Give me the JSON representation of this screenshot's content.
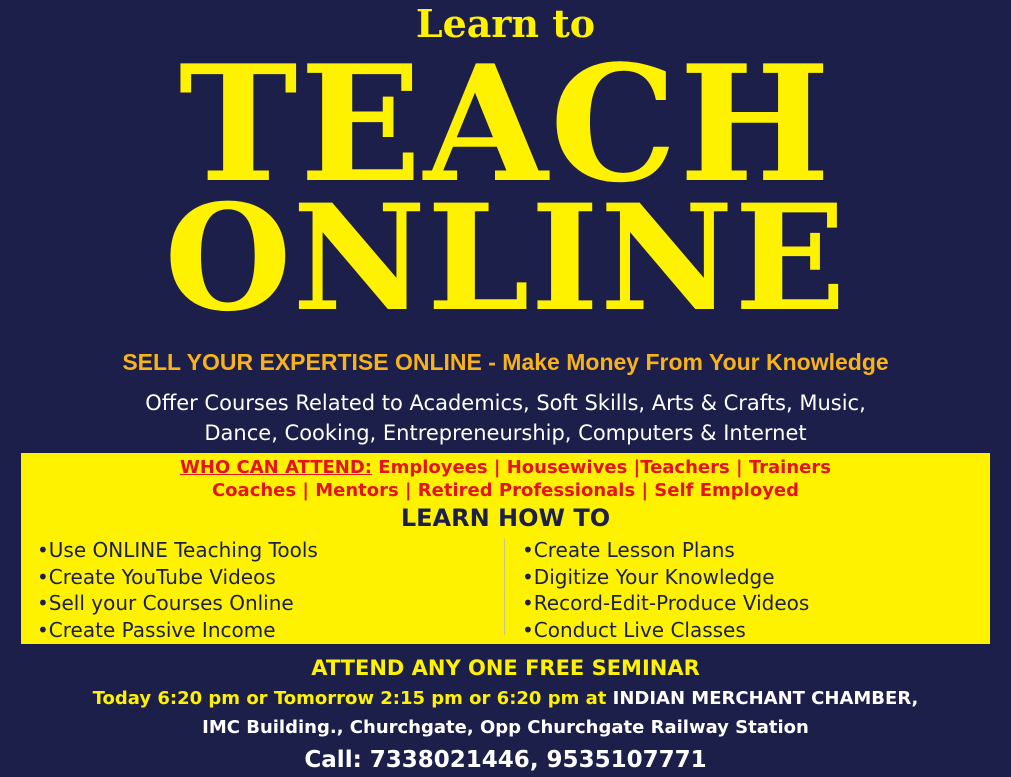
{
  "header": {
    "kicker": "Learn to",
    "line1": "TEACH",
    "line2": "ONLINE"
  },
  "tagline": "SELL YOUR EXPERTISE ONLINE - Make Money From Your Knowledge",
  "offer": {
    "line1": "Offer Courses Related to Academics, Soft Skills, Arts & Crafts, Music,",
    "line2": "Dance, Cooking, Entrepreneurship, Computers & Internet"
  },
  "who": {
    "label": "WHO CAN ATTEND:",
    "line1_rest": " Employees | Housewives |Teachers | Trainers",
    "line2": "Coaches | Mentors | Retired Professionals | Self Employed"
  },
  "learn_how": {
    "heading": "LEARN HOW TO",
    "left": [
      "•Use ONLINE Teaching Tools",
      "•Create YouTube Videos",
      "•Sell your Courses Online",
      "•Create Passive Income"
    ],
    "right": [
      "•Create Lesson Plans",
      "•Digitize Your Knowledge",
      "•Record-Edit-Produce Videos",
      "•Conduct Live Classes"
    ]
  },
  "seminar": {
    "heading": "ATTEND ANY ONE FREE SEMINAR",
    "time_text": "Today 6:20 pm or Tomorrow 2:15 pm or 6:20 pm at ",
    "venue_text": "INDIAN MERCHANT CHAMBER,",
    "address": "IMC Building., Churchgate, Opp Churchgate Railway Station"
  },
  "contact": "Call: 7338021446, 9535107771",
  "colors": {
    "background": "#1c1f4a",
    "headline": "#fff200",
    "tagline": "#f7b21c",
    "panel": "#fff200",
    "who_text": "#e3141c"
  }
}
